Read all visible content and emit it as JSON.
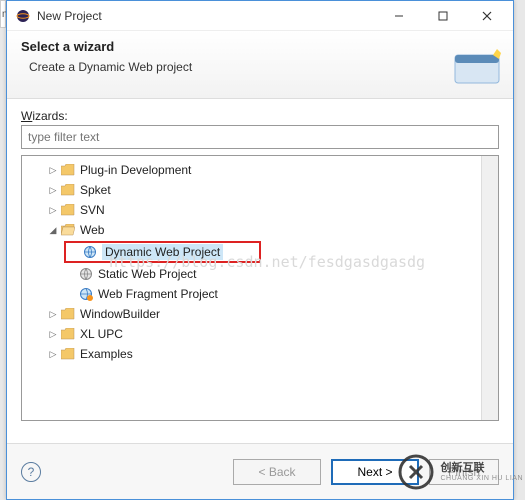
{
  "titlebar": {
    "title": "New Project"
  },
  "header": {
    "heading": "Select a wizard",
    "subtext": "Create a Dynamic Web project"
  },
  "filter": {
    "label": "Wizards:",
    "placeholder": "type filter text"
  },
  "tree": {
    "nodes": [
      {
        "label": "Plug-in Development"
      },
      {
        "label": "Spket"
      },
      {
        "label": "SVN"
      },
      {
        "label": "Web"
      },
      {
        "label": "Dynamic Web Project"
      },
      {
        "label": "Static Web Project"
      },
      {
        "label": "Web Fragment Project"
      },
      {
        "label": "WindowBuilder"
      },
      {
        "label": "XL UPC"
      },
      {
        "label": "Examples"
      }
    ]
  },
  "buttons": {
    "back": "< Back",
    "next": "Next >",
    "finish": "Finish"
  },
  "watermark_url": "https://blog.csdn.net/fesdgasdgasdg",
  "wm": {
    "main": "创新互联",
    "sub": "CHUANG XIN HU LIAN"
  }
}
